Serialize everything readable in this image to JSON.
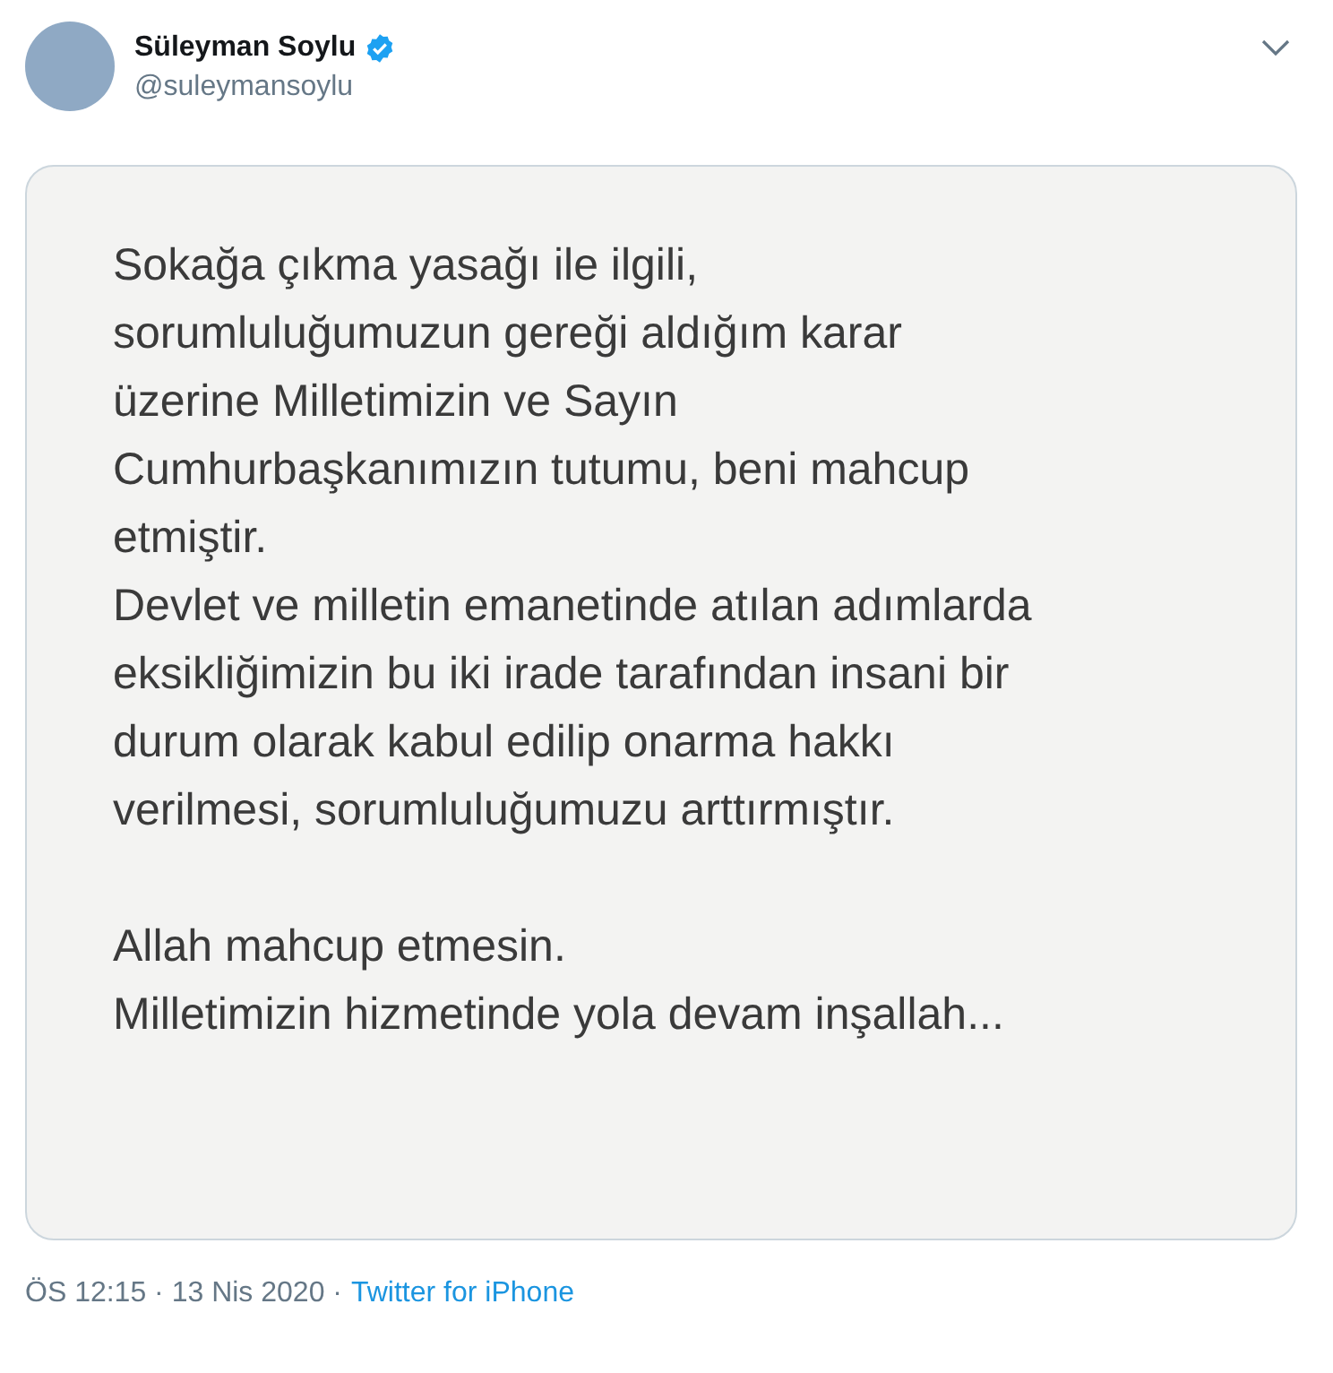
{
  "author": {
    "name": "Süleyman Soylu",
    "verified": true,
    "handle": "@suleymansoylu"
  },
  "note": {
    "paragraphs": [
      [
        "Sokağa çıkma yasağı ile ilgili,",
        "sorumluluğumuzun gereği aldığım karar",
        "üzerine Milletimizin ve Sayın",
        "Cumhurbaşkanımızın tutumu, beni mahcup",
        "etmiştir.",
        "Devlet ve milletin emanetinde atılan adımlarda",
        "eksikliğimizin bu iki irade tarafından insani bir",
        "durum olarak kabul edilip onarma hakkı",
        "verilmesi, sorumluluğumuzu arttırmıştır."
      ],
      [
        "Allah mahcup etmesin.",
        "Milletimizin hizmetinde yola devam inşallah..."
      ]
    ]
  },
  "footer": {
    "time": "ÖS 12:15 · 13 Nis 2020 ·",
    "source": "Twitter for iPhone"
  }
}
